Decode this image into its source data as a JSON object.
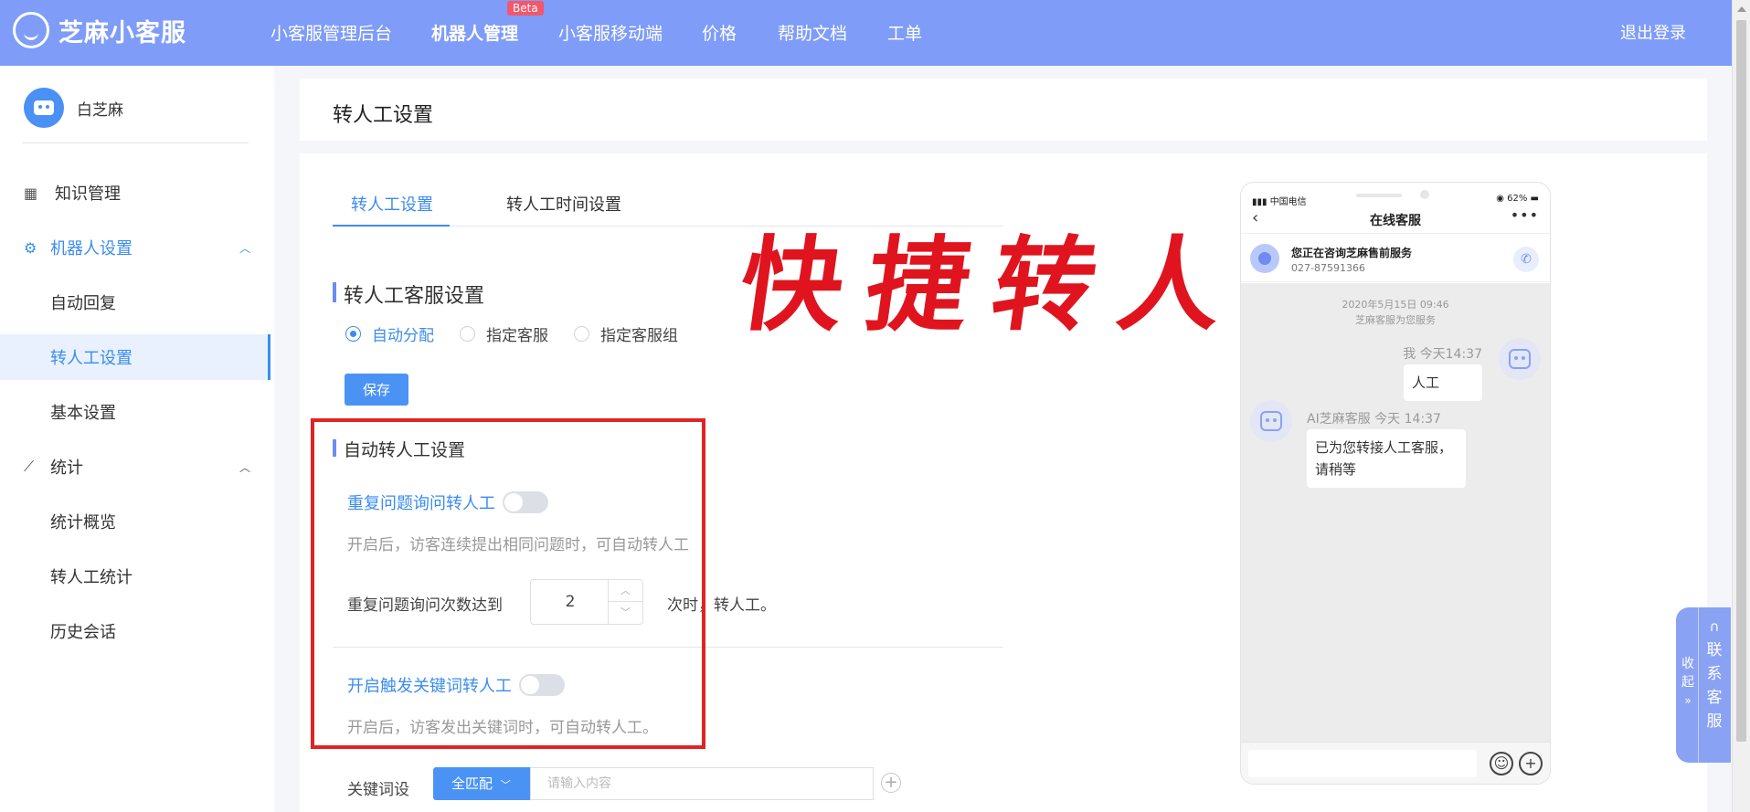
{
  "app": {
    "name": "芝麻小客服"
  },
  "nav": {
    "items": [
      "小客服管理后台",
      "机器人管理",
      "小客服移动端",
      "价格",
      "帮助文档",
      "工单"
    ],
    "active_index": 1,
    "beta_badge": "Beta",
    "logout": "退出登录"
  },
  "sidebar": {
    "profile_name": "白芝麻",
    "items": [
      {
        "label": "知识管理",
        "icon": "grid-icon"
      },
      {
        "label": "机器人设置",
        "icon": "gear-icon",
        "expanded": true
      },
      {
        "label": "自动回复"
      },
      {
        "label": "转人工设置",
        "selected": true
      },
      {
        "label": "基本设置"
      },
      {
        "label": "统计",
        "icon": "chart-icon",
        "expanded": true
      },
      {
        "label": "统计概览"
      },
      {
        "label": "转人工统计"
      },
      {
        "label": "历史会话"
      }
    ]
  },
  "page": {
    "title": "转人工设置",
    "tabs": [
      "转人工设置",
      "转人工时间设置"
    ],
    "active_tab": 0
  },
  "service_settings": {
    "title": "转人工客服设置",
    "options": [
      "自动分配",
      "指定客服",
      "指定客服组"
    ],
    "selected_option": 0,
    "save_label": "保存"
  },
  "auto_transfer": {
    "title": "自动转人工设置",
    "repeat_label": "重复问题询问转人工",
    "repeat_enabled": false,
    "repeat_hint": "开启后，访客连续提出相同问题时，可自动转人工",
    "count_prefix": "重复问题询问次数达到",
    "count_value": "2",
    "count_suffix": "次时，转人工。",
    "keyword_label": "开启触发关键词转人工",
    "keyword_enabled": false,
    "keyword_hint": "开启后，访客发出关键词时，可自动转人工。"
  },
  "keyword_row": {
    "label": "关键词设",
    "match_mode": "全匹配",
    "placeholder": "请输入内容"
  },
  "overlay_caption": "快捷转人工",
  "phone": {
    "carrier": "中国电信",
    "battery": "62%",
    "header_title": "在线客服",
    "banner_title": "您正在咨询芝麻售前服务",
    "banner_phone": "027-87591366",
    "timestamp": "2020年5月15日 09:46",
    "service_note": "芝麻客服为您服务",
    "user_name": "我 今天14:37",
    "user_message": "人工",
    "bot_name": "AI芝麻客服 今天 14:37",
    "bot_message": "已为您转接人工客服，请稍等"
  },
  "float_widget": {
    "collapse": "收起",
    "contact": "联系客服"
  },
  "colors": {
    "topbar": "#7e9cf8",
    "accent": "#3b8cf0",
    "highlight_border": "#e02424"
  }
}
